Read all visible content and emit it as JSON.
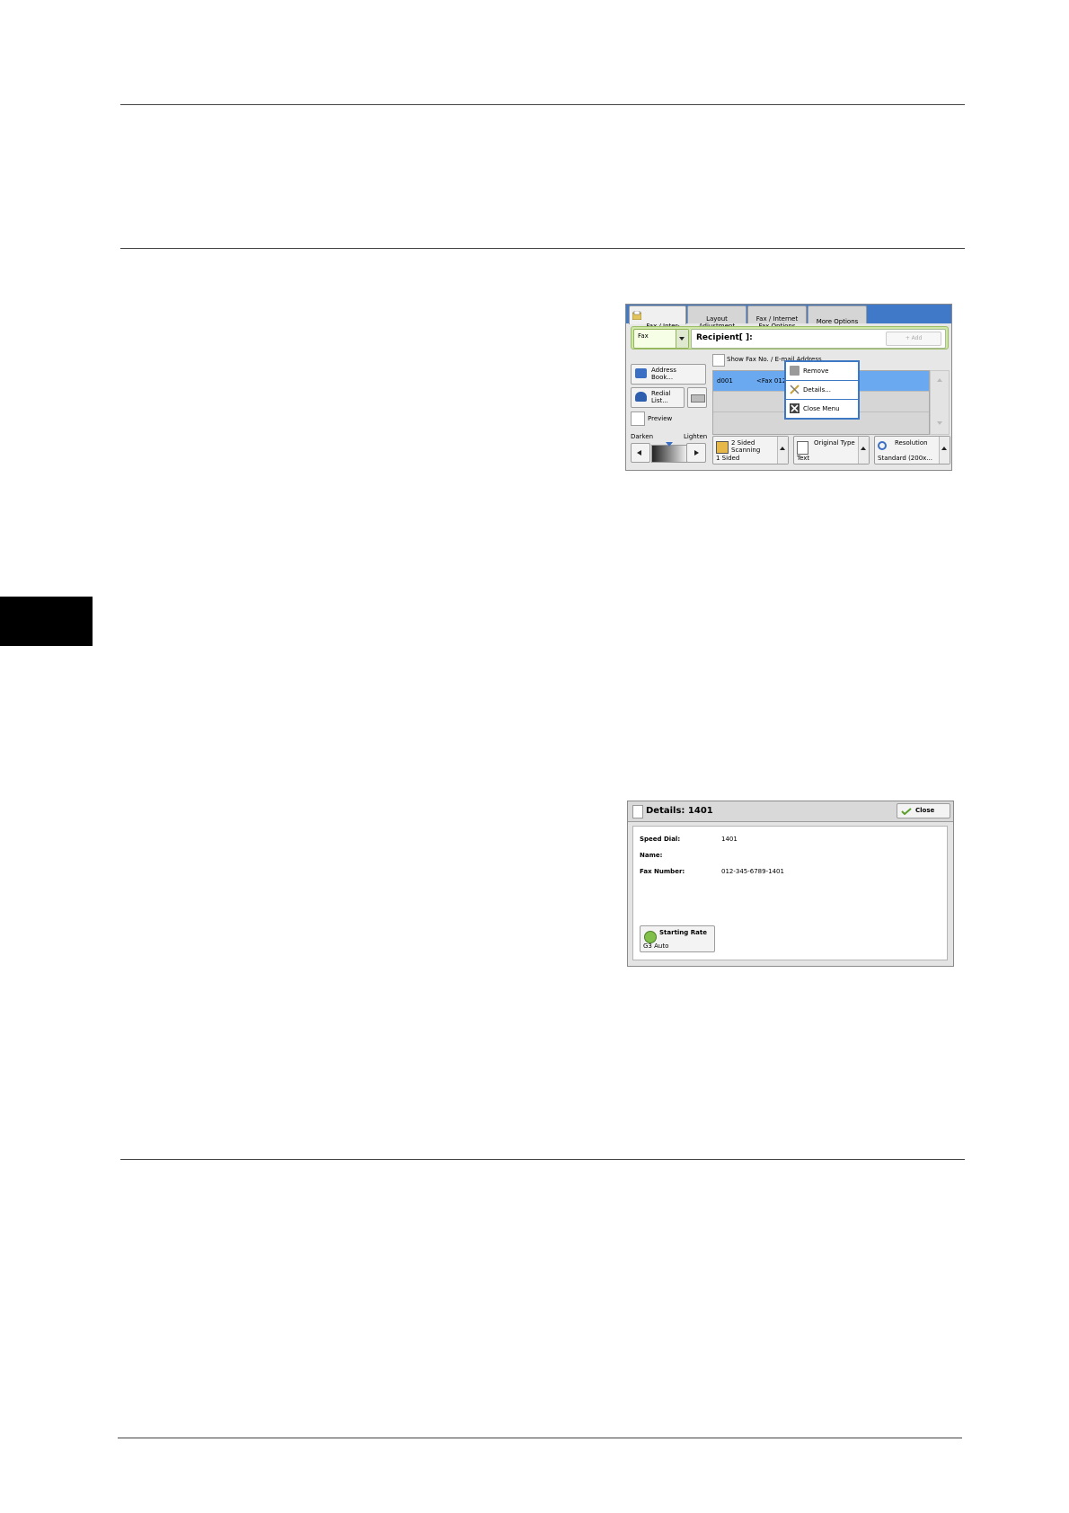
{
  "fax_screen": {
    "tabs": [
      {
        "label": "Fax / Inter-\nnet Fax"
      },
      {
        "label": "Layout\nAdjustment"
      },
      {
        "label": "Fax / Internet\nFax Options"
      },
      {
        "label": "More Options"
      }
    ],
    "fax_select": "Fax",
    "recipient_label": "Recipient[    ]:",
    "add_label": "+ Add",
    "show_fax_label": "Show Fax No. / E-mail Address",
    "address_book_label": "Address\nBook...",
    "redial_label": "Redial\nList...",
    "preview_label": "Preview",
    "darken_label": "Darken",
    "lighten_label": "Lighten",
    "list_row": {
      "id": "d001",
      "value": "<Fax 012"
    },
    "menu": {
      "remove": "Remove",
      "details": "Details...",
      "close_menu": "Close Menu"
    },
    "two_sided": {
      "title": "2 Sided\nScanning",
      "value": "1 Sided"
    },
    "original_type": {
      "title": "Original Type",
      "value": "Text"
    },
    "resolution": {
      "title": "Resolution",
      "value": "Standard (200x..."
    }
  },
  "details_screen": {
    "title": "Details: 1401",
    "close_label": "Close",
    "speed_dial_label": "Speed Dial:",
    "speed_dial_value": "1401",
    "name_label": "Name:",
    "name_value": "",
    "fax_number_label": "Fax Number:",
    "fax_number_value": "012-345-6789-1401",
    "starting_rate_label": "Starting Rate",
    "starting_rate_value": "G3 Auto"
  }
}
